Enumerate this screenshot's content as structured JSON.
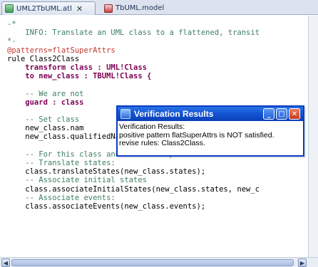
{
  "tabs": [
    {
      "label": "UML2TbUML.atl",
      "active": true
    },
    {
      "label": "TbUML.model",
      "active": false
    }
  ],
  "code_lines": [
    {
      "cls": "c-comment",
      "text": "-*"
    },
    {
      "cls": "c-comment",
      "text": "    INFO: Translate an UML class to a flattened, transit"
    },
    {
      "cls": "c-comment",
      "text": "*-"
    },
    {
      "cls": "c-annot",
      "text": "@patterns=flatSuperAttrs"
    },
    {
      "cls": "c-plain",
      "text": "rule Class2Class"
    },
    {
      "cls": "c-kw",
      "text": "    transform class : UML!Class"
    },
    {
      "cls": "c-kw",
      "text": "    to new_class : TBUML!Class {"
    },
    {
      "cls": "c-plain",
      "text": ""
    },
    {
      "cls": "c-comment",
      "text": "    -- We are not"
    },
    {
      "cls": "c-kw",
      "text": "    guard : class"
    },
    {
      "cls": "c-plain",
      "text": ""
    },
    {
      "cls": "c-comment",
      "text": "    -- Set class"
    },
    {
      "cls": "c-plain",
      "text": "    new_class.nam"
    },
    {
      "cls": "c-plain",
      "text": "    new_class.qualifiedName := class.qualifiedName;"
    },
    {
      "cls": "c-plain",
      "text": ""
    },
    {
      "cls": "c-comment",
      "text": "    -- For this class and all its superclasses:"
    },
    {
      "cls": "c-comment",
      "text": "    -- Translate states:"
    },
    {
      "cls": "c-plain",
      "text": "    class.translateStates(new_class.states);"
    },
    {
      "cls": "c-comment",
      "text": "    -- Associate initial states"
    },
    {
      "cls": "c-plain",
      "text": "    class.associateInitialStates(new_class.states, new_c"
    },
    {
      "cls": "c-comment",
      "text": "    -- Associate events:"
    },
    {
      "cls": "c-plain",
      "text": "    class.associateEvents(new_class.events);"
    }
  ],
  "dialog": {
    "title": "Verification Results",
    "lines": [
      "Verification Results:",
      "positive pattern flatSuperAttrs is NOT satisfied.",
      " revise rules: Class2Class."
    ],
    "min_label": "_",
    "max_label": "□",
    "close_label": "✕"
  },
  "scroll": {
    "left_arrow": "◀",
    "right_arrow": "▶"
  },
  "colors": {
    "titlebar": "#1655d4",
    "comment": "#3f7f5f",
    "keyword": "#7f0055",
    "annotation": "#c0392b"
  }
}
